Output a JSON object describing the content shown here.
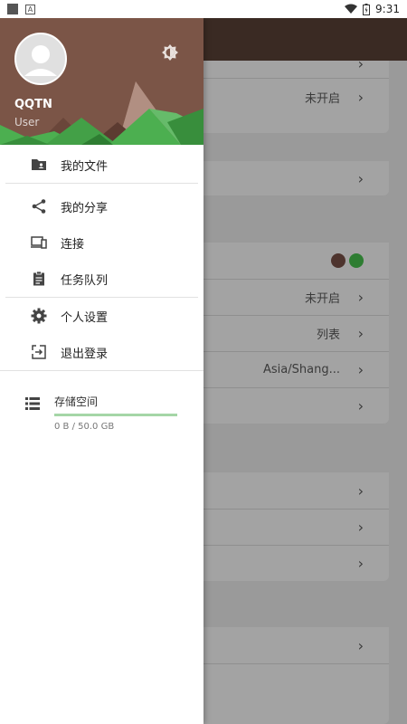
{
  "status_bar": {
    "time": "9:31"
  },
  "drawer": {
    "user": {
      "name": "QQTN",
      "role": "User"
    },
    "menu_primary": [
      {
        "label": "我的文件",
        "icon": "folder-shared-icon"
      }
    ],
    "menu_secondary": [
      {
        "label": "我的分享",
        "icon": "share-icon"
      },
      {
        "label": "连接",
        "icon": "devices-icon"
      },
      {
        "label": "任务队列",
        "icon": "clipboard-icon"
      }
    ],
    "menu_tertiary": [
      {
        "label": "个人设置",
        "icon": "gear-icon"
      },
      {
        "label": "退出登录",
        "icon": "logout-icon"
      }
    ],
    "storage": {
      "label": "存储空间",
      "usage": "0 B / 50.0 GB",
      "used_fraction": 0.0
    }
  },
  "background": {
    "rows_top": {
      "status": "未开启"
    },
    "theme_colors": {
      "dark": "#4e342e",
      "green": "#2e7d32"
    },
    "rows_mid": [
      {
        "value": "未开启"
      },
      {
        "value": "列表"
      },
      {
        "value": "Asia/Shang..."
      }
    ]
  },
  "colors": {
    "header": "#7b5547",
    "toolbar": "#3a2a23",
    "accent": "#4caf50"
  }
}
